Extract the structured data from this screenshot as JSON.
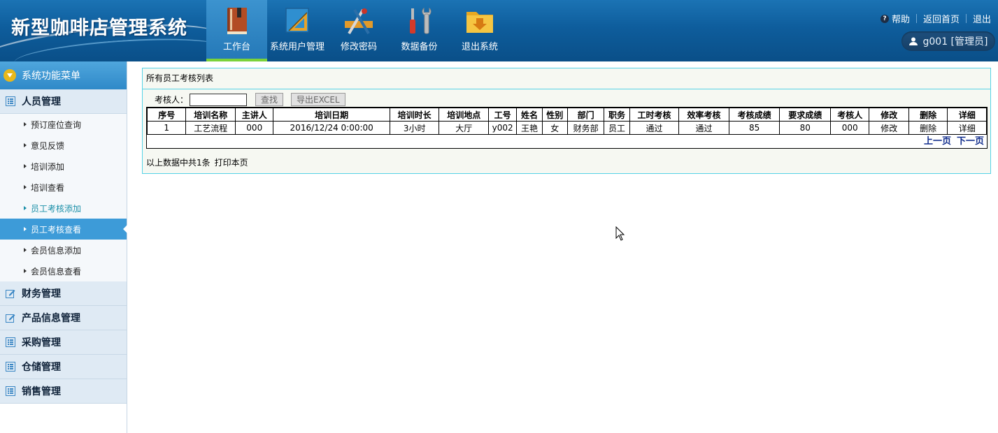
{
  "header": {
    "brand": "新型咖啡店管理系统",
    "nav": [
      {
        "label": "工作台",
        "icon": "book-icon",
        "active": true
      },
      {
        "label": "系统用户管理",
        "icon": "ruler-icon",
        "active": false
      },
      {
        "label": "修改密码",
        "icon": "tools-icon",
        "active": false
      },
      {
        "label": "数据备份",
        "icon": "screwdriver-wrench-icon",
        "active": false
      },
      {
        "label": "退出系统",
        "icon": "folder-download-icon",
        "active": false
      }
    ],
    "links": {
      "help": "帮助",
      "home": "返回首页",
      "logout": "退出"
    },
    "user": "g001 [管理员]"
  },
  "sidebar": {
    "title": "系统功能菜单",
    "groups": [
      {
        "label": "人员管理",
        "items": [
          {
            "label": "预订座位查询"
          },
          {
            "label": "意见反馈"
          },
          {
            "label": "培训添加"
          },
          {
            "label": "培训查看"
          },
          {
            "label": "员工考核添加"
          },
          {
            "label": "员工考核查看"
          },
          {
            "label": "会员信息添加"
          },
          {
            "label": "会员信息查看"
          }
        ]
      },
      {
        "label": "财务管理"
      },
      {
        "label": "产品信息管理"
      },
      {
        "label": "采购管理"
      },
      {
        "label": "仓储管理"
      },
      {
        "label": "销售管理"
      }
    ]
  },
  "main": {
    "title": "所有员工考核列表",
    "search": {
      "label": "考核人：",
      "value": "",
      "search_btn": "查找",
      "export_btn": "导出EXCEL"
    },
    "columns": [
      "序号",
      "培训名称",
      "主讲人",
      "培训日期",
      "培训时长",
      "培训地点",
      "工号",
      "姓名",
      "性别",
      "部门",
      "职务",
      "工时考核",
      "效率考核",
      "考核成绩",
      "要求成绩",
      "考核人",
      "修改",
      "删除",
      "详细"
    ],
    "rows": [
      [
        "1",
        "工艺流程",
        "000",
        "2016/12/24 0:00:00",
        "3小时",
        "大厅",
        "y002",
        "王艳",
        "女",
        "财务部",
        "员工",
        "通过",
        "通过",
        "85",
        "80",
        "000",
        "修改",
        "删除",
        "详细"
      ]
    ],
    "pager": {
      "prev": "上一页",
      "next": "下一页"
    },
    "footer": {
      "summary": "以上数据中共1条",
      "print": "打印本页"
    }
  }
}
